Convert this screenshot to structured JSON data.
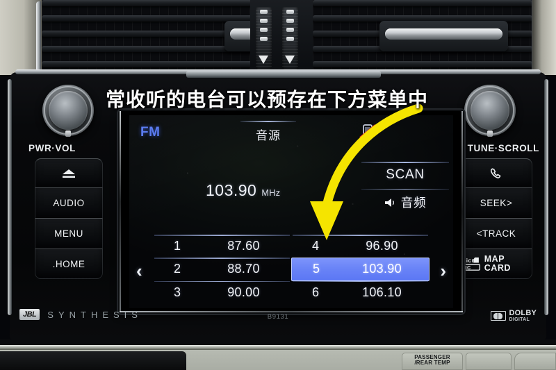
{
  "annotation": {
    "text": "常收听的电台可以预存在下方菜单中",
    "arrow_color": "#f5e400",
    "arrow_name": "yellow-curved-arrow"
  },
  "vents": {
    "name": "dashboard-air-vents",
    "left_knob": "vent-direction-knob-left",
    "right_knob": "vent-direction-knob-right",
    "slider_left": "vent-airflow-slider-left",
    "slider_right": "vent-airflow-slider-right"
  },
  "left_controls": {
    "knob_label": "PWR·VOL",
    "buttons": [
      {
        "label": "⏏",
        "name": "eject-button",
        "icon": "eject-icon"
      },
      {
        "label": "AUDIO",
        "name": "audio-button"
      },
      {
        "label": "MENU",
        "name": "menu-button"
      },
      {
        "label": ".HOME",
        "name": "home-button"
      }
    ]
  },
  "right_controls": {
    "knob_label": "TUNE·SCROLL",
    "buttons": [
      {
        "label": "✆",
        "name": "phone-button",
        "icon": "phone-icon"
      },
      {
        "label": "SEEK>",
        "name": "seek-button"
      },
      {
        "label": "<TRACK",
        "name": "track-button"
      },
      {
        "label": "MAP CARD",
        "sub": "microSDHC",
        "name": "map-card-slot"
      }
    ]
  },
  "screen": {
    "band": "FM",
    "source_tab": "音源",
    "status_icon": "phone-disconnected-icon",
    "frequency": "103.90",
    "frequency_unit": "MHz",
    "side_buttons": [
      {
        "label": "SCAN",
        "name": "scan-button"
      },
      {
        "label": "音频",
        "name": "audio-settings-button",
        "icon": "speaker-icon"
      }
    ],
    "prev_arrow": "‹",
    "next_arrow": "›",
    "presets": [
      {
        "num": "1",
        "freq": "87.60",
        "active": false
      },
      {
        "num": "4",
        "freq": "96.90",
        "active": false
      },
      {
        "num": "2",
        "freq": "88.70",
        "active": false
      },
      {
        "num": "5",
        "freq": "103.90",
        "active": true
      },
      {
        "num": "3",
        "freq": "90.00",
        "active": false
      },
      {
        "num": "6",
        "freq": "106.10",
        "active": false
      }
    ],
    "highlight_color": "#6a84f7",
    "band_color": "#5b7cf0"
  },
  "branding": {
    "jbl": "JBL",
    "synthesis": "SYNTHESIS",
    "model": "B9131",
    "dolby_line1": "DOLBY",
    "dolby_line2": "DIGITAL"
  },
  "hvac": {
    "passenger_button_line1": "PASSENGER",
    "passenger_button_line2": "/REAR TEMP"
  }
}
